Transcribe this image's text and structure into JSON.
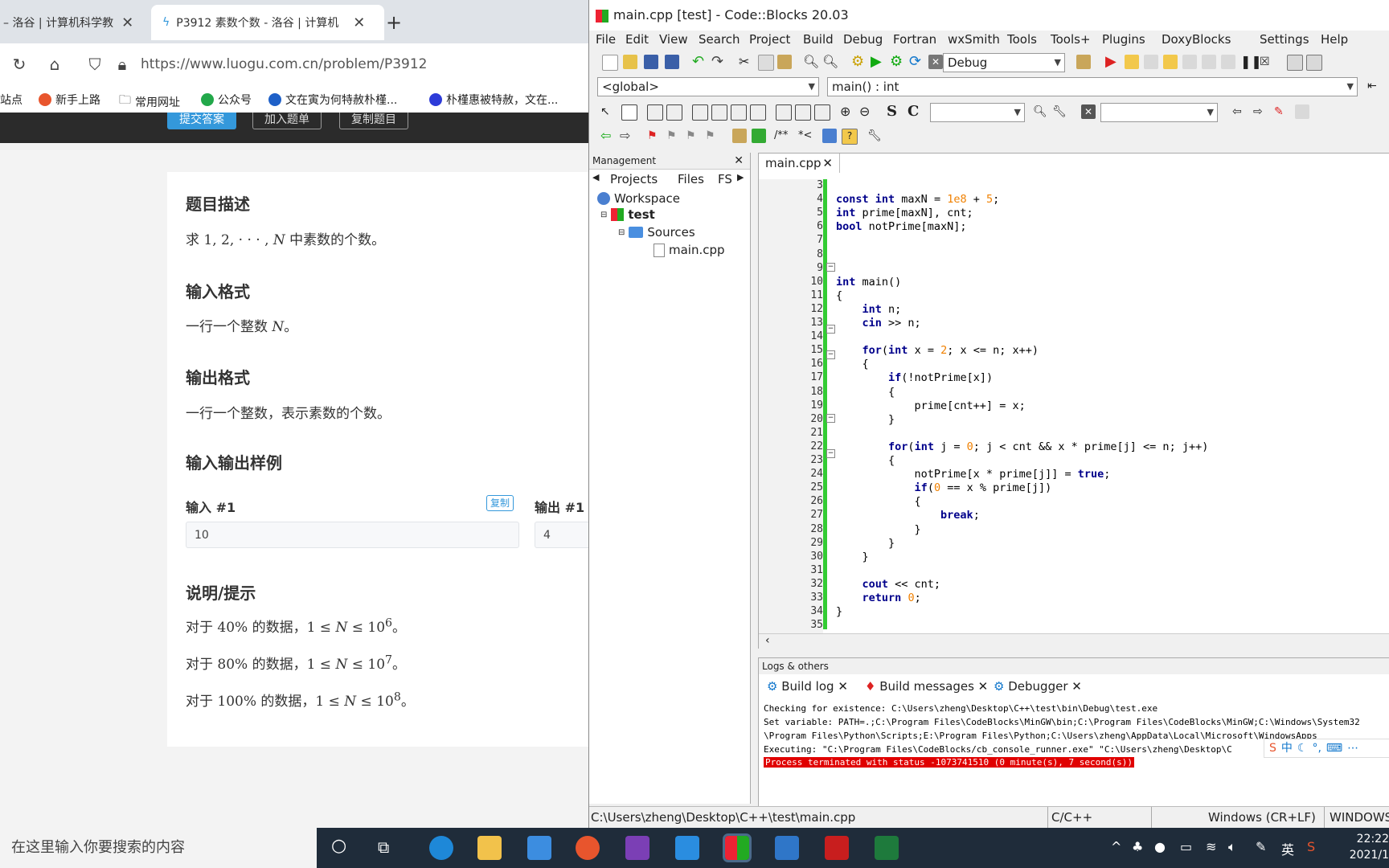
{
  "browser": {
    "tabs": [
      {
        "label": "– 洛谷 | 计算机科学教",
        "active": false
      },
      {
        "label": "P3912 素数个数 - 洛谷 | 计算机",
        "active": true
      }
    ],
    "new_tab": "+",
    "url": "https://www.luogu.com.cn/problem/P3912",
    "bookmarks": [
      "站点",
      "新手上路",
      "常用网址",
      "公众号",
      "文在寅为何特赦朴槿...",
      "朴槿惠被特赦，文在..."
    ],
    "action_buttons": [
      "提交答案",
      "加入题单",
      "复制题目"
    ],
    "problem": {
      "desc_title": "题目描述",
      "desc_pre": "求 1, 2, · · · , ",
      "desc_var": "N",
      "desc_post": " 中素数的个数。",
      "input_title": "输入格式",
      "input_pre": "一行一个整数 ",
      "input_var": "N",
      "input_post": "。",
      "output_title": "输出格式",
      "output_text": "一行一个整数，表示素数的个数。",
      "sample_title": "输入输出样例",
      "input1_label": "输入 #1",
      "copy_label": "复制",
      "input1_value": "10",
      "output1_label": "输出 #1",
      "output1_value": "4",
      "hint_title": "说明/提示",
      "hints": [
        {
          "pre": "对于 40% 的数据，1 ≤ ",
          "var": "N",
          "mid": " ≤ 10",
          "sup": "6",
          "post": "。"
        },
        {
          "pre": "对于 80% 的数据，1 ≤ ",
          "var": "N",
          "mid": " ≤ 10",
          "sup": "7",
          "post": "。"
        },
        {
          "pre": "对于 100% 的数据，1 ≤ ",
          "var": "N",
          "mid": " ≤ 10",
          "sup": "8",
          "post": "。"
        }
      ]
    }
  },
  "ide": {
    "title": "main.cpp [test] - Code::Blocks 20.03",
    "menu": [
      "File",
      "Edit",
      "View",
      "Search",
      "Project",
      "Build",
      "Debug",
      "Fortran",
      "wxSmith",
      "Tools",
      "Tools+",
      "Plugins",
      "DoxyBlocks",
      "Settings",
      "Help"
    ],
    "build_target": "Debug",
    "scope": "<global>",
    "function": "main() : int",
    "management": {
      "title": "Management",
      "tabs": [
        "Projects",
        "Files",
        "FS"
      ],
      "workspace": "Workspace",
      "project": "test",
      "folder": "Sources",
      "file": "main.cpp"
    },
    "editor_tab": "main.cpp",
    "line_numbers": [
      "3",
      "4",
      "5",
      "6",
      "7",
      "8",
      "9",
      "10",
      "11",
      "12",
      "13",
      "14",
      "15",
      "16",
      "17",
      "18",
      "19",
      "20",
      "21",
      "22",
      "23",
      "24",
      "25",
      "26",
      "27",
      "28",
      "29",
      "30",
      "31",
      "32",
      "33",
      "34",
      "35"
    ],
    "code_lines": [
      "",
      "const int maxN = 1e8 + 5;",
      "int prime[maxN], cnt;",
      "bool notPrime[maxN];",
      "",
      "",
      "",
      "int main()",
      "{",
      "    int n;",
      "    cin >> n;",
      "",
      "    for(int x = 2; x <= n; x++)",
      "    {",
      "        if(!notPrime[x])",
      "        {",
      "            prime[cnt++] = x;",
      "        }",
      "",
      "        for(int j = 0; j < cnt && x * prime[j] <= n; j++)",
      "        {",
      "            notPrime[x * prime[j]] = true;",
      "            if(0 == x % prime[j])",
      "            {",
      "                break;",
      "            }",
      "        }",
      "    }",
      "",
      "    cout << cnt;",
      "    return 0;",
      "}",
      ""
    ],
    "logs": {
      "title": "Logs & others",
      "tabs": [
        "Build log",
        "Build messages",
        "Debugger"
      ],
      "lines": [
        "Checking for existence: C:\\Users\\zheng\\Desktop\\C++\\test\\bin\\Debug\\test.exe",
        "Set variable: PATH=.;C:\\Program Files\\CodeBlocks\\MinGW\\bin;C:\\Program Files\\CodeBlocks\\MinGW;C:\\Windows\\System32",
        "\\Program Files\\Python\\Scripts;E:\\Program Files\\Python;C:\\Users\\zheng\\AppData\\Local\\Microsoft\\WindowsApps",
        "Executing: \"C:\\Program Files\\CodeBlocks/cb_console_runner.exe\" \"C:\\Users\\zheng\\Desktop\\C"
      ],
      "error_line": "Process terminated with status -1073741510 (0 minute(s), 7 second(s))"
    },
    "status": {
      "path": "C:\\Users\\zheng\\Desktop\\C++\\test\\main.cpp",
      "lang": "C/C++",
      "eol": "Windows (CR+LF)",
      "encoding": "WINDOWS"
    }
  },
  "taskbar": {
    "search_placeholder": "在这里输入你要搜索的内容",
    "time": "22:22",
    "date": "2021/1",
    "ime": "英",
    "ime_toolbar": [
      "中"
    ]
  }
}
